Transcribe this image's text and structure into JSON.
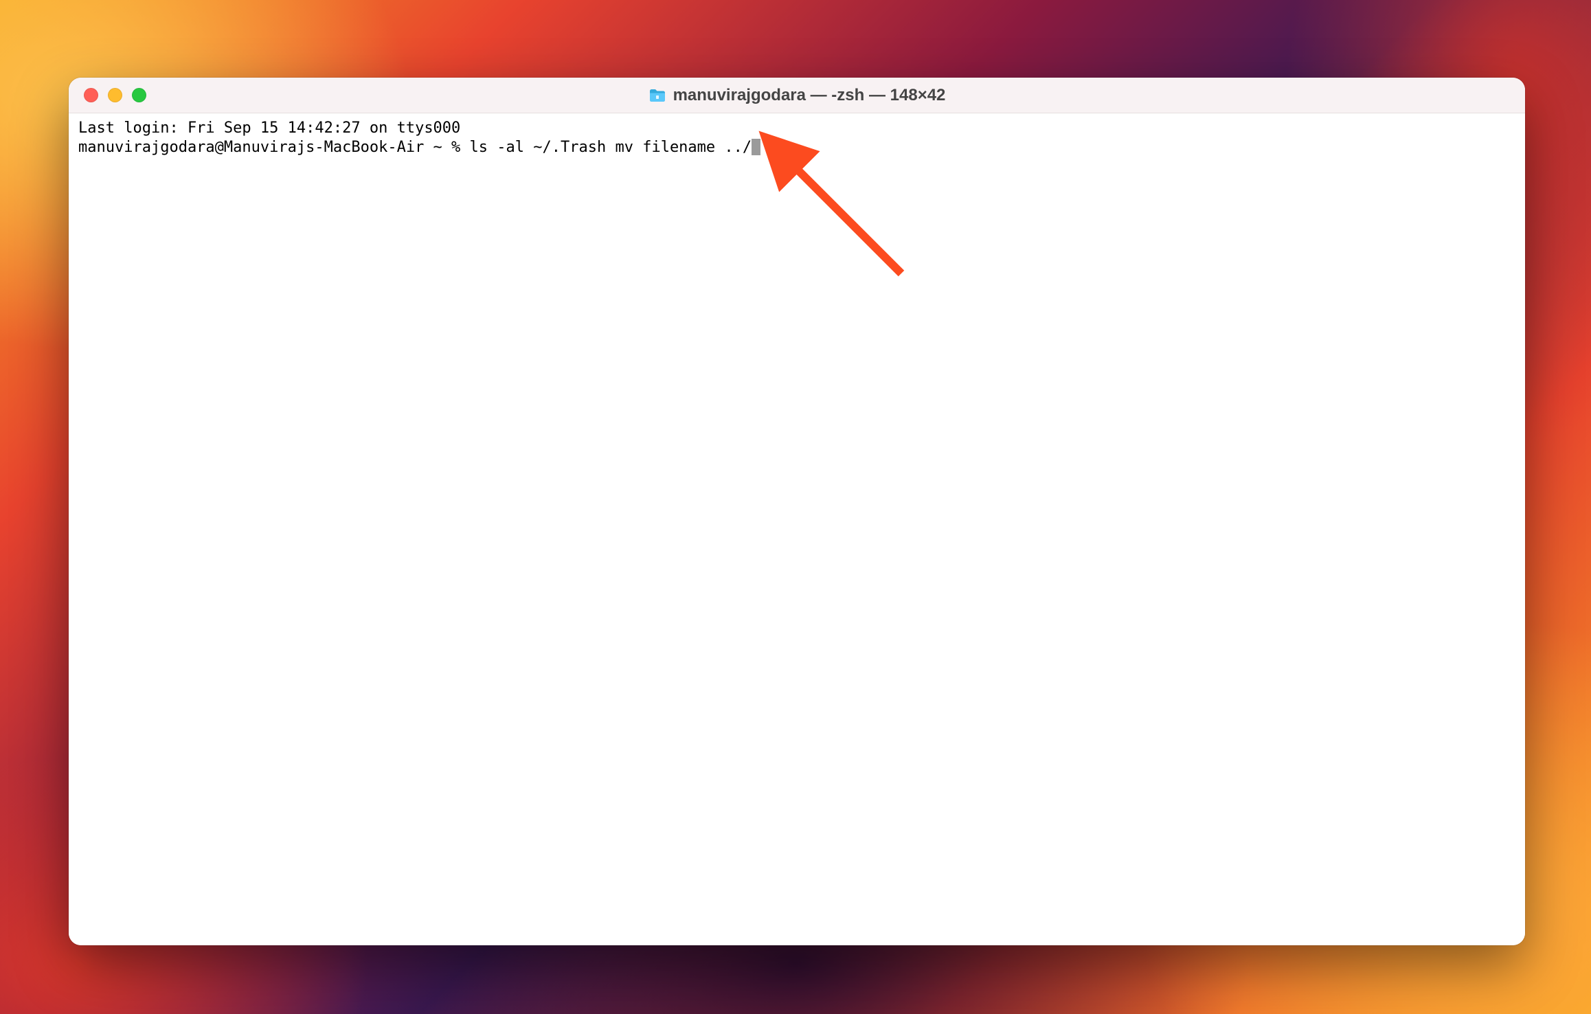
{
  "window": {
    "title": "manuvirajgodara — -zsh — 148×42"
  },
  "terminal": {
    "last_login_line": "Last login: Fri Sep 15 14:42:27 on ttys000",
    "prompt": "manuvirajgodara@Manuvirajs-MacBook-Air ~ % ",
    "command": "ls -al ~/.Trash mv filename ../"
  },
  "icons": {
    "folder": "folder-icon",
    "close": "close-icon",
    "minimize": "minimize-icon",
    "maximize": "maximize-icon"
  },
  "colors": {
    "close": "#ff5f57",
    "minimize": "#febc2e",
    "maximize": "#28c840",
    "arrow": "#fc4b1f"
  }
}
